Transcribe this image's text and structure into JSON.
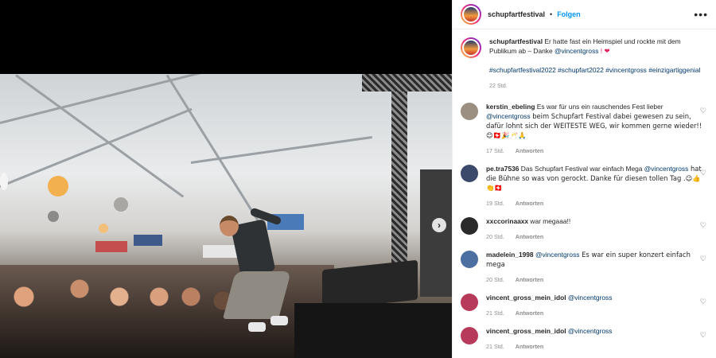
{
  "post": {
    "username": "schupfartfestival",
    "follow_label": "Folgen",
    "more_label": "•••",
    "next_label": "›"
  },
  "caption": {
    "username": "schupfartfestival",
    "text": "Er hatte fast ein Heimspiel und rockte mit dem Publikum ab – Danke",
    "mention": "@vincentgross",
    "tail": " ! ❤",
    "hashtags": "#schupfartfestival2022 #schupfart2022 #vincentgross #einzigartiggenial",
    "time": "22 Std."
  },
  "comments": [
    {
      "username": "kerstin_ebeling",
      "text_before": "Es war für uns ein rauschendes Fest lieber ",
      "mention": "@vincentgross",
      "text_after": " beim Schupfart Festival dabei gewesen zu sein, dafür lohnt sich der WEITESTE WEG, wir kommen gerne wieder!!😊🇨🇭🎉🥂🙏",
      "time": "17 Std.",
      "reply": "Antworten",
      "avatar_color": "#9a8f80"
    },
    {
      "username": "pe.tra7536",
      "text_before": "Das Schupfart Festival war einfach Mega ",
      "mention": "@vincentgross",
      "text_after": " hat die Bühne so was von gerockt. Danke für diesen tollen Tag .😉👍👏🇨🇭",
      "time": "19 Std.",
      "reply": "Antworten",
      "avatar_color": "#3b4a6b"
    },
    {
      "username": "xxccorinaaxx",
      "text_before": "war megaaa!!",
      "mention": "",
      "text_after": "",
      "time": "20 Std.",
      "reply": "Antworten",
      "avatar_color": "#2a2a2a"
    },
    {
      "username": "madelein_1998",
      "text_before": "",
      "mention": "@vincentgross",
      "text_after": " Es war ein super konzert einfach mega",
      "time": "20 Std.",
      "reply": "Antworten",
      "avatar_color": "#4a6fa0"
    },
    {
      "username": "vincent_gross_mein_idol",
      "text_before": "",
      "mention": "@vincentgross",
      "text_after": "",
      "time": "21 Std.",
      "reply": "Antworten",
      "avatar_color": "#b83a5a"
    },
    {
      "username": "vincent_gross_mein_idol",
      "text_before": "",
      "mention": "@vincentgross",
      "text_after": "",
      "time": "21 Std.",
      "reply": "Antworten",
      "avatar_color": "#b83a5a"
    }
  ],
  "icons": {
    "heart": "heart-outline-icon",
    "more": "more-horizontal-icon",
    "next": "chevron-right-icon"
  }
}
